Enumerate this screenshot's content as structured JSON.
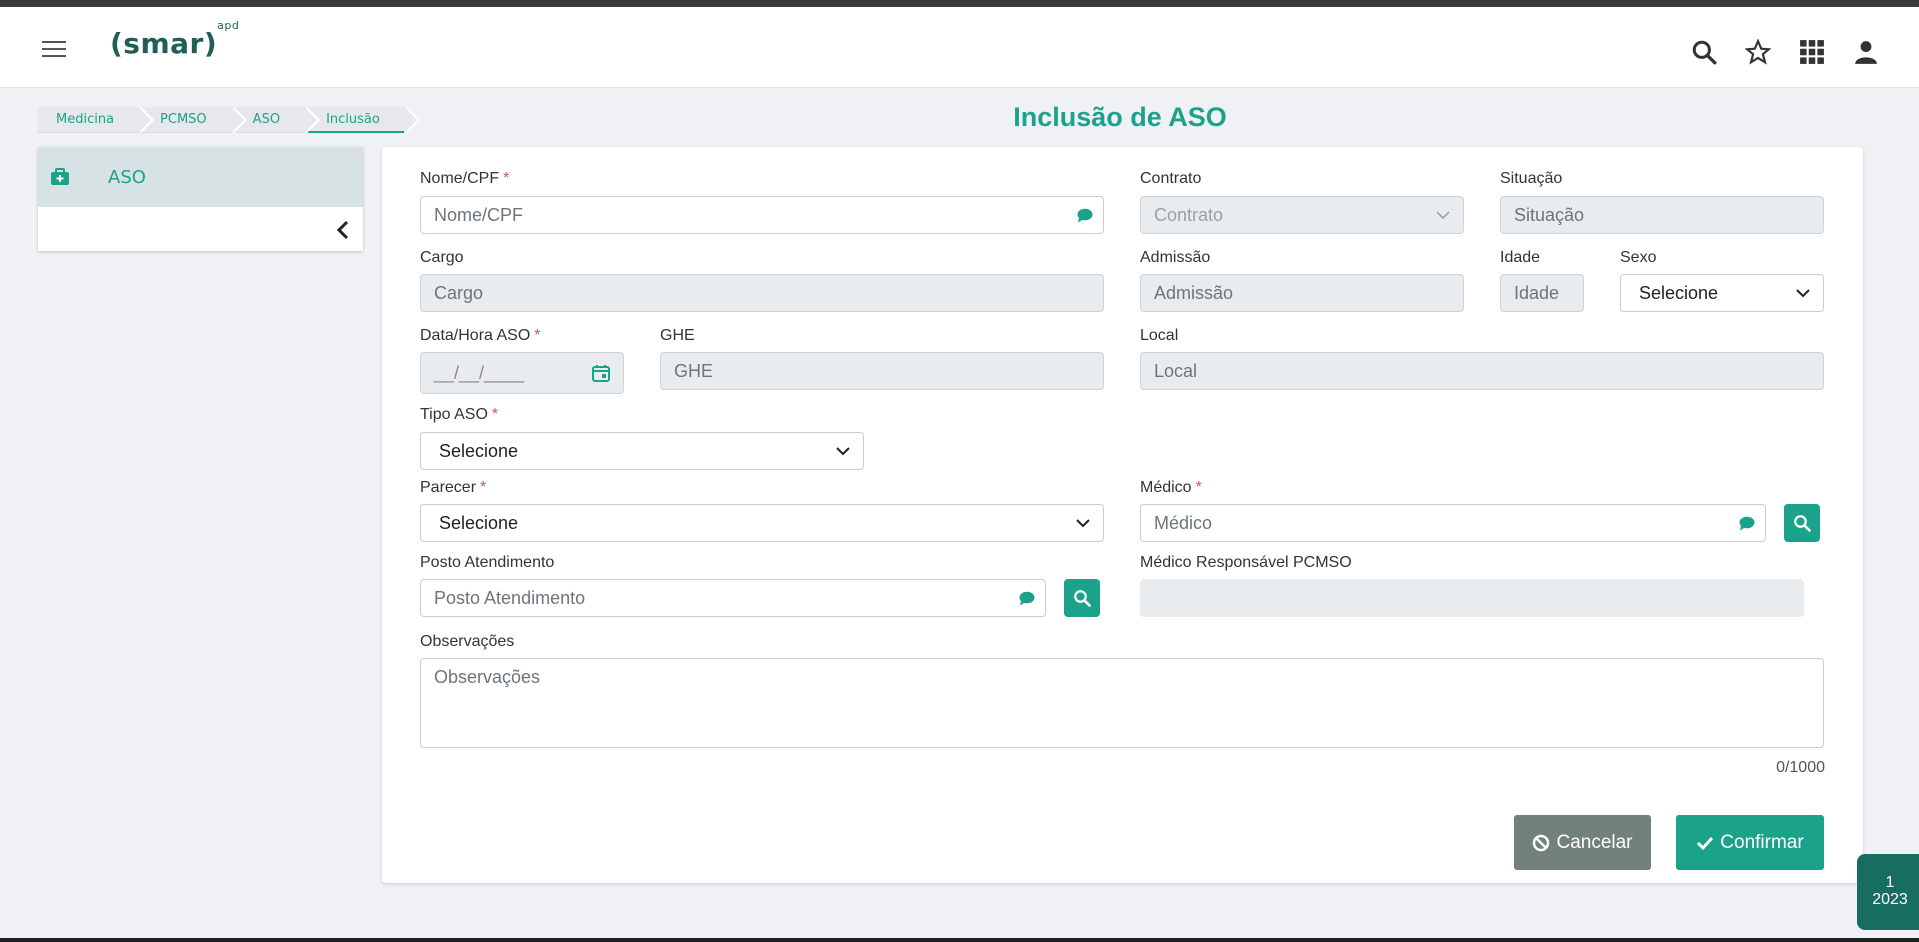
{
  "header": {
    "logo_word": "(smar)",
    "logo_super": "apd"
  },
  "breadcrumb": [
    "Medicina",
    "PCMSO",
    "ASO",
    "Inclusão"
  ],
  "page_title": "Inclusão de ASO",
  "sidebar": {
    "items": [
      {
        "label": "ASO"
      }
    ]
  },
  "form": {
    "nome_cpf": {
      "label": "Nome/CPF",
      "placeholder": "Nome/CPF",
      "required": "*"
    },
    "contrato": {
      "label": "Contrato",
      "placeholder": "Contrato"
    },
    "situacao": {
      "label": "Situação",
      "placeholder": "Situação"
    },
    "cargo": {
      "label": "Cargo",
      "placeholder": "Cargo"
    },
    "admissao": {
      "label": "Admissão",
      "placeholder": "Admissão"
    },
    "idade": {
      "label": "Idade",
      "placeholder": "Idade"
    },
    "sexo": {
      "label": "Sexo",
      "value": "Selecione"
    },
    "data_hora": {
      "label": "Data/Hora ASO",
      "placeholder": "__/__/____",
      "required": "*"
    },
    "ghe": {
      "label": "GHE",
      "placeholder": "GHE"
    },
    "local": {
      "label": "Local",
      "placeholder": "Local"
    },
    "tipo_aso": {
      "label": "Tipo ASO",
      "value": "Selecione",
      "required": "*"
    },
    "parecer": {
      "label": "Parecer",
      "value": "Selecione",
      "required": "*"
    },
    "medico": {
      "label": "Médico",
      "placeholder": "Médico",
      "required": "*"
    },
    "posto": {
      "label": "Posto Atendimento",
      "placeholder": "Posto Atendimento"
    },
    "medico_resp": {
      "label": "Médico Responsável PCMSO"
    },
    "observacoes": {
      "label": "Observações",
      "placeholder": "Observações",
      "counter": "0/1000"
    }
  },
  "actions": {
    "cancel_label": "Cancelar",
    "confirm_label": "Confirmar"
  },
  "year_badge": {
    "line1": "1",
    "line2": "2023"
  },
  "colors": {
    "accent": "#1aa38a",
    "cancel": "#73817e",
    "badge": "#176d5f"
  }
}
